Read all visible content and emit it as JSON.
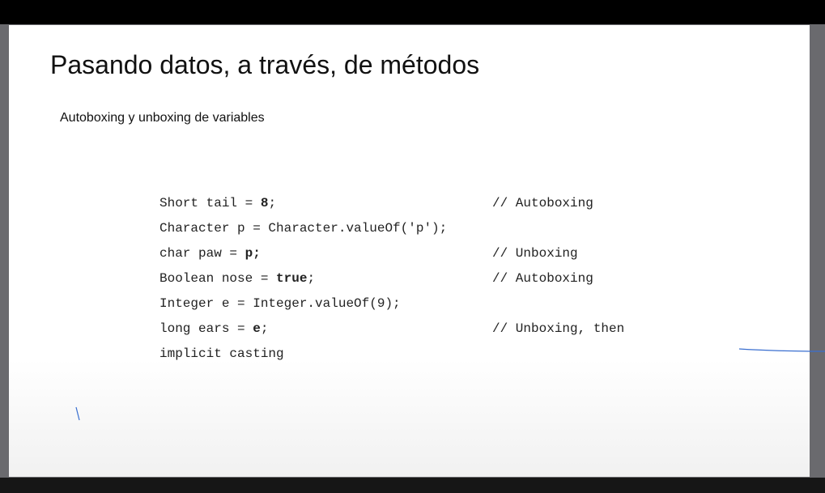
{
  "slide": {
    "title": "Pasando datos, a través, de métodos",
    "subtitle": "Autoboxing y unboxing de variables"
  },
  "code": {
    "lines": [
      {
        "pre": "Short tail = ",
        "bold": "8",
        "post": ";",
        "comment": "// Autoboxing"
      },
      {
        "pre": "Character p = Character.valueOf('p');",
        "bold": "",
        "post": "",
        "comment": ""
      },
      {
        "pre": "char paw = ",
        "bold": "p;",
        "post": "",
        "comment": "// Unboxing"
      },
      {
        "pre": "Boolean nose = ",
        "bold": "true",
        "post": ";",
        "comment": "// Autoboxing"
      },
      {
        "pre": "Integer e = Integer.valueOf(9);",
        "bold": "",
        "post": "",
        "comment": ""
      },
      {
        "pre": "long ears = ",
        "bold": "e",
        "post": ";",
        "comment": "// Unboxing, then"
      },
      {
        "pre": "implicit casting",
        "bold": "",
        "post": "",
        "comment": ""
      }
    ]
  },
  "colors": {
    "ink": "#3a6fd0",
    "slide_background": "#ffffff",
    "frame": "#000000"
  }
}
